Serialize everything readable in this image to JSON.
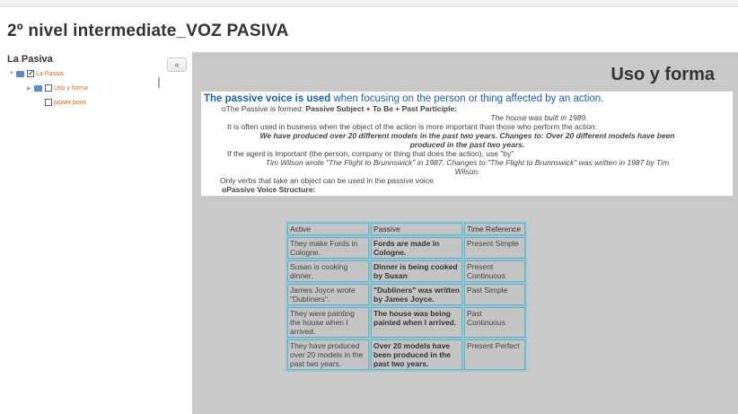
{
  "page_title": "2º nivel intermediate_VOZ PASIVA",
  "sidebar": {
    "title": "La Pasiva",
    "collapse_label": "«",
    "tree": [
      {
        "label": "La Pasiva",
        "checked": true
      },
      {
        "label": "Uso y forma",
        "checked": false
      },
      {
        "label": "power point",
        "checked": false
      }
    ]
  },
  "main": {
    "heading": "Uso y forma",
    "lead_bold": "The passive voice is used",
    "lead_rest": " when focusing on the person or thing affected by an action.",
    "lines": {
      "formed_prefix": "The Passive is formed: ",
      "formed_bold": "Passive Subject + To Be + Past Participle:",
      "example1": "The house was built in 1989.",
      "business": "It is often used in business when the object of the action is more important than those who perform the action:",
      "models_a": "We have produced over 20 different models in the past two years. Changes to: Over 20 different models have been",
      "models_b": "produced in the past two years.",
      "agent": "If the agent is important (the person, company or thing that does the action), use \"by\"",
      "wilson_a": "Tim Wilson wrote \"The Flight to Brunnswick\" in 1987. Changes to:\"The Flight to Brunnswick\" was written in 1987 by Tim",
      "wilson_b": "Wilson.",
      "only_verbs": "Only verbs that take an object can be used in the passive voice.",
      "structure": "Passive Voice Structure:"
    },
    "table": {
      "headers": [
        "Active",
        "Passive",
        "Time Reference"
      ],
      "rows": [
        [
          "They make Fords in Cologne.",
          "Fords are made in Cologne.",
          "Present Simple"
        ],
        [
          "Susan is cooking dinner.",
          "Dinner is being cooked by Susan",
          "Present Continuous"
        ],
        [
          "James Joyce wrote \"Dubliners\".",
          "\"Dubliners\" was written by James Joyce.",
          "Past Simple"
        ],
        [
          "They were painting the house when I arrived.",
          "The house was being painted when I arrived.",
          "Past Continuous"
        ],
        [
          "They have produced over 20 models in the past two years.",
          "Over 20 models have been produced in the past two years.",
          "Present Perfect"
        ]
      ]
    }
  },
  "colors": {
    "lead_blue": "#1a5fb0",
    "tree_orange": "#e06a1a",
    "panel_gray": "#c9c9c9",
    "table_border": "#6ab0c0"
  }
}
